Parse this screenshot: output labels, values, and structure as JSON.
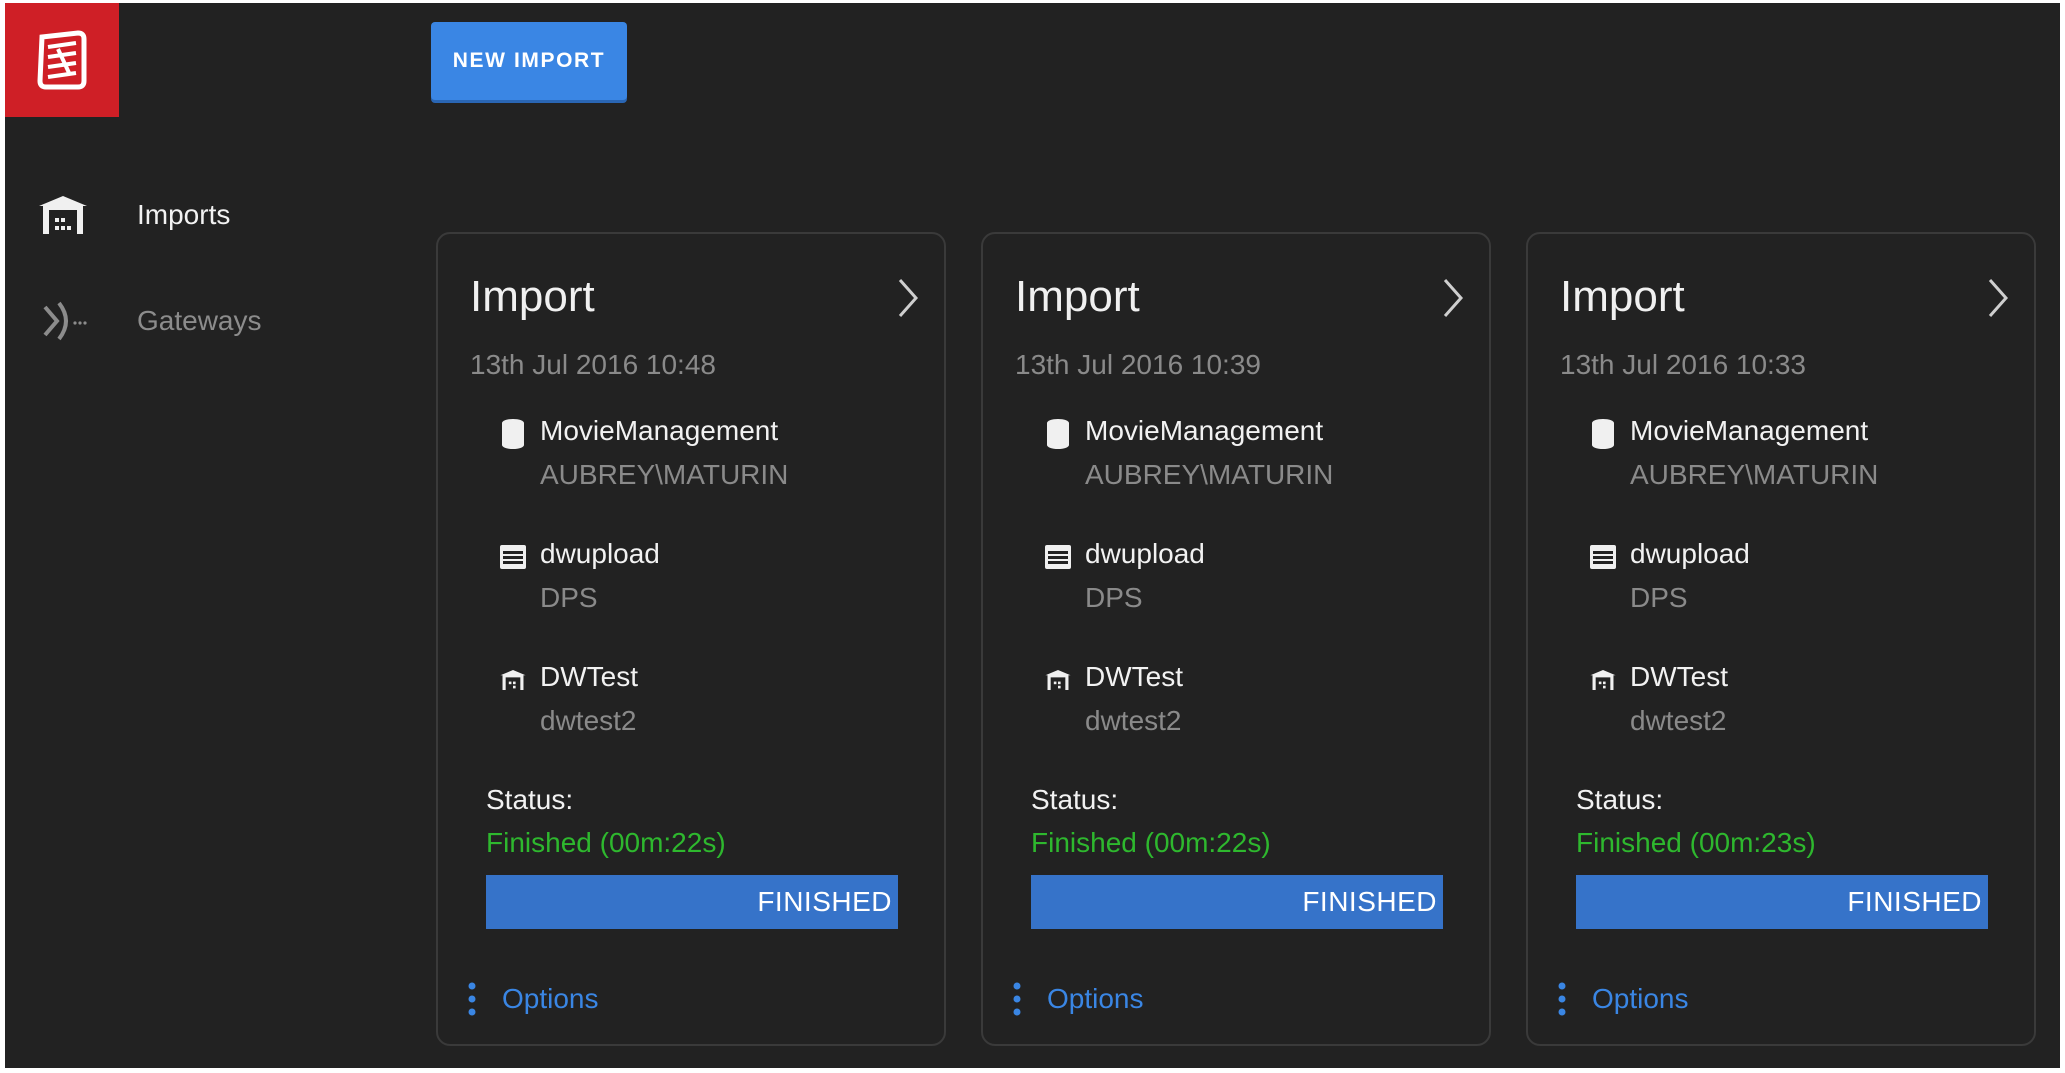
{
  "sidebar": {
    "items": [
      {
        "label": "Imports",
        "icon": "warehouse-icon",
        "active": true
      },
      {
        "label": "Gateways",
        "icon": "gateway-icon",
        "active": false
      }
    ]
  },
  "toolbar": {
    "new_import_label": "NEW IMPORT"
  },
  "colors": {
    "brand": "#cf1f26",
    "accent": "#3a86e4",
    "progress": "#3673c9",
    "status_ok": "#2eb82e",
    "background": "#222222"
  },
  "cards": [
    {
      "title": "Import",
      "date": "13th Jul 2016 10:48",
      "database": {
        "name": "MovieManagement",
        "server": "AUBREY\\MATURIN"
      },
      "source": {
        "name": "dwupload",
        "schema": "DPS"
      },
      "warehouse": {
        "name": "DWTest",
        "instance": "dwtest2"
      },
      "status_label": "Status:",
      "status_text": "Finished (00m:22s)",
      "progress_label": "FINISHED",
      "progress_fraction": 1.0,
      "options_label": "Options"
    },
    {
      "title": "Import",
      "date": "13th Jul 2016 10:39",
      "database": {
        "name": "MovieManagement",
        "server": "AUBREY\\MATURIN"
      },
      "source": {
        "name": "dwupload",
        "schema": "DPS"
      },
      "warehouse": {
        "name": "DWTest",
        "instance": "dwtest2"
      },
      "status_label": "Status:",
      "status_text": "Finished (00m:22s)",
      "progress_label": "FINISHED",
      "progress_fraction": 1.0,
      "options_label": "Options"
    },
    {
      "title": "Import",
      "date": "13th Jul 2016 10:33",
      "database": {
        "name": "MovieManagement",
        "server": "AUBREY\\MATURIN"
      },
      "source": {
        "name": "dwupload",
        "schema": "DPS"
      },
      "warehouse": {
        "name": "DWTest",
        "instance": "dwtest2"
      },
      "status_label": "Status:",
      "status_text": "Finished (00m:23s)",
      "progress_label": "FINISHED",
      "progress_fraction": 1.0,
      "options_label": "Options"
    }
  ]
}
